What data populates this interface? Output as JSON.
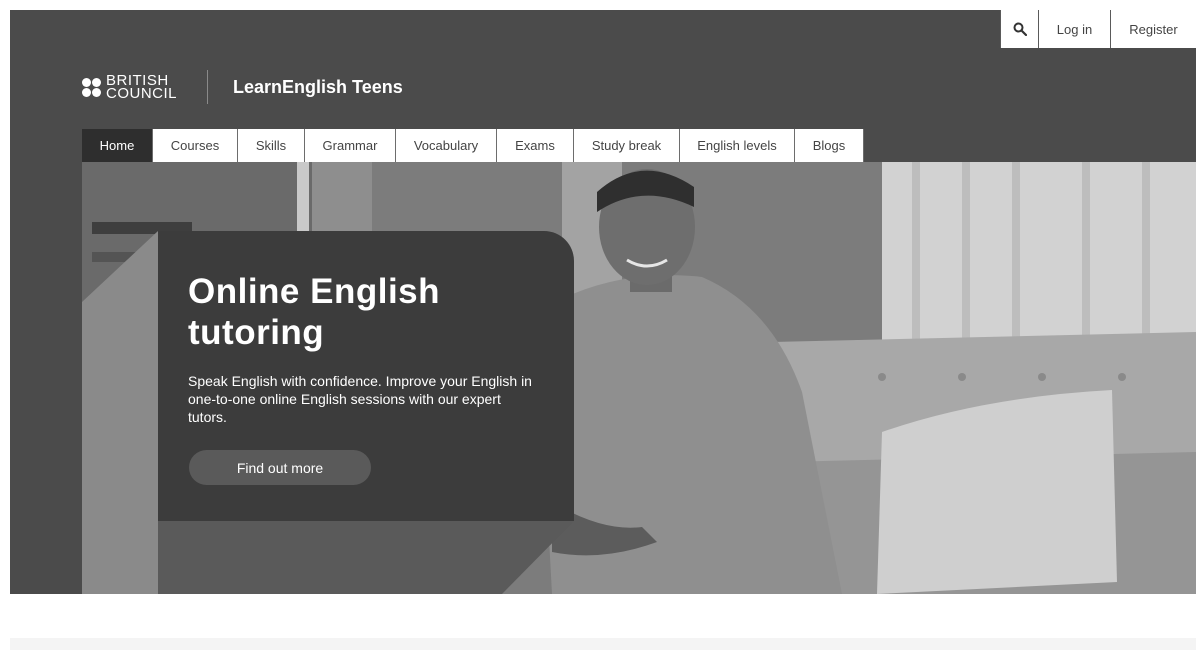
{
  "utility": {
    "login_label": "Log in",
    "register_label": "Register"
  },
  "brand": {
    "org_line1": "BRITISH",
    "org_line2": "COUNCIL",
    "site_title": "LearnEnglish Teens"
  },
  "nav": {
    "items": [
      {
        "label": "Home",
        "active": true
      },
      {
        "label": "Courses"
      },
      {
        "label": "Skills"
      },
      {
        "label": "Grammar"
      },
      {
        "label": "Vocabulary"
      },
      {
        "label": "Exams"
      },
      {
        "label": "Study break"
      },
      {
        "label": "English levels"
      },
      {
        "label": "Blogs"
      }
    ]
  },
  "hero": {
    "title": "Online English tutoring",
    "description": "Speak English with confidence. Improve your English in one-to-one online English sessions with our expert tutors.",
    "cta_label": "Find out more"
  },
  "icons": {
    "search": "search-icon",
    "logo_dots": "british-council-dots-icon"
  },
  "colors": {
    "header_bg": "#4b4b4b",
    "card_bg": "#3c3c3c",
    "button_bg": "#5a5a5a",
    "active_tab": "#2e2e2e"
  }
}
